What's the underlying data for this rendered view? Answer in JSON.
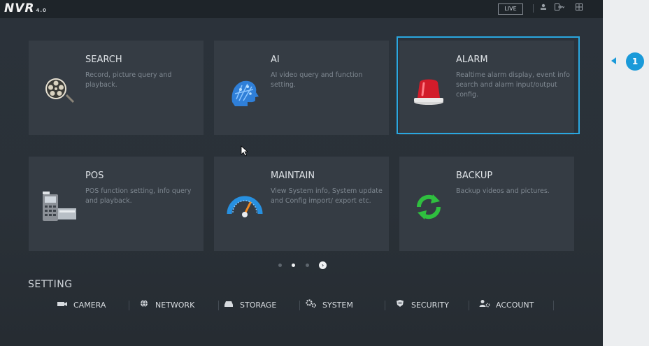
{
  "topbar": {
    "logo_text": "NVR",
    "logo_version": "4.0",
    "live_label": "LIVE",
    "icons": [
      "user-icon",
      "logout-icon",
      "grid-icon"
    ]
  },
  "tiles": [
    {
      "title": "SEARCH",
      "desc": "Record, picture query and playback.",
      "icon": "film-reel-icon"
    },
    {
      "title": "AI",
      "desc": "AI video query and function setting.",
      "icon": "ai-head-icon"
    },
    {
      "title": "ALARM",
      "desc": "Realtime alarm display, event info search and alarm input/output config.",
      "icon": "alarm-siren-icon",
      "selected": true
    },
    {
      "title": "POS",
      "desc": "POS function setting, info query and playback.",
      "icon": "pos-terminal-icon"
    },
    {
      "title": "MAINTAIN",
      "desc": "View System info, System update and Config import/ export etc.",
      "icon": "gauge-icon"
    },
    {
      "title": "BACKUP",
      "desc": "Backup videos and pictures.",
      "icon": "sync-arrows-icon"
    }
  ],
  "pagination": {
    "pages": 3,
    "current": 1
  },
  "setting": {
    "label": "SETTING",
    "items": [
      {
        "label": "CAMERA",
        "icon": "camera-icon"
      },
      {
        "label": "NETWORK",
        "icon": "globe-icon"
      },
      {
        "label": "STORAGE",
        "icon": "storage-icon"
      },
      {
        "label": "SYSTEM",
        "icon": "gears-icon"
      },
      {
        "label": "SECURITY",
        "icon": "shield-icon"
      },
      {
        "label": "ACCOUNT",
        "icon": "account-icon"
      }
    ]
  },
  "callout": {
    "number": "1"
  },
  "colors": {
    "accent": "#2aa7e0",
    "callout": "#1a9ad9",
    "tile": "#353c44",
    "background": "#2b323a"
  }
}
